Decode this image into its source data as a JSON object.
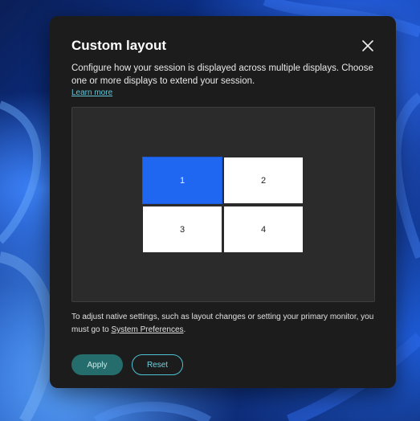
{
  "dialog": {
    "title": "Custom layout",
    "description": "Configure how your session is displayed across multiple displays. Choose one or more displays to extend your session.",
    "learn_more": "Learn more",
    "note_prefix": "To adjust native settings, such as layout changes or setting your primary monitor, you must go to ",
    "note_link": "System Preferences",
    "note_suffix": ".",
    "apply_label": "Apply",
    "reset_label": "Reset"
  },
  "displays": [
    {
      "label": "1",
      "selected": true
    },
    {
      "label": "2",
      "selected": false
    },
    {
      "label": "3",
      "selected": false
    },
    {
      "label": "4",
      "selected": false
    }
  ],
  "colors": {
    "accent": "#1f66f0",
    "link": "#63c5d8",
    "apply_bg": "#256d6d",
    "dialog_bg": "#1c1c1c"
  },
  "icons": {
    "close": "close-icon"
  }
}
